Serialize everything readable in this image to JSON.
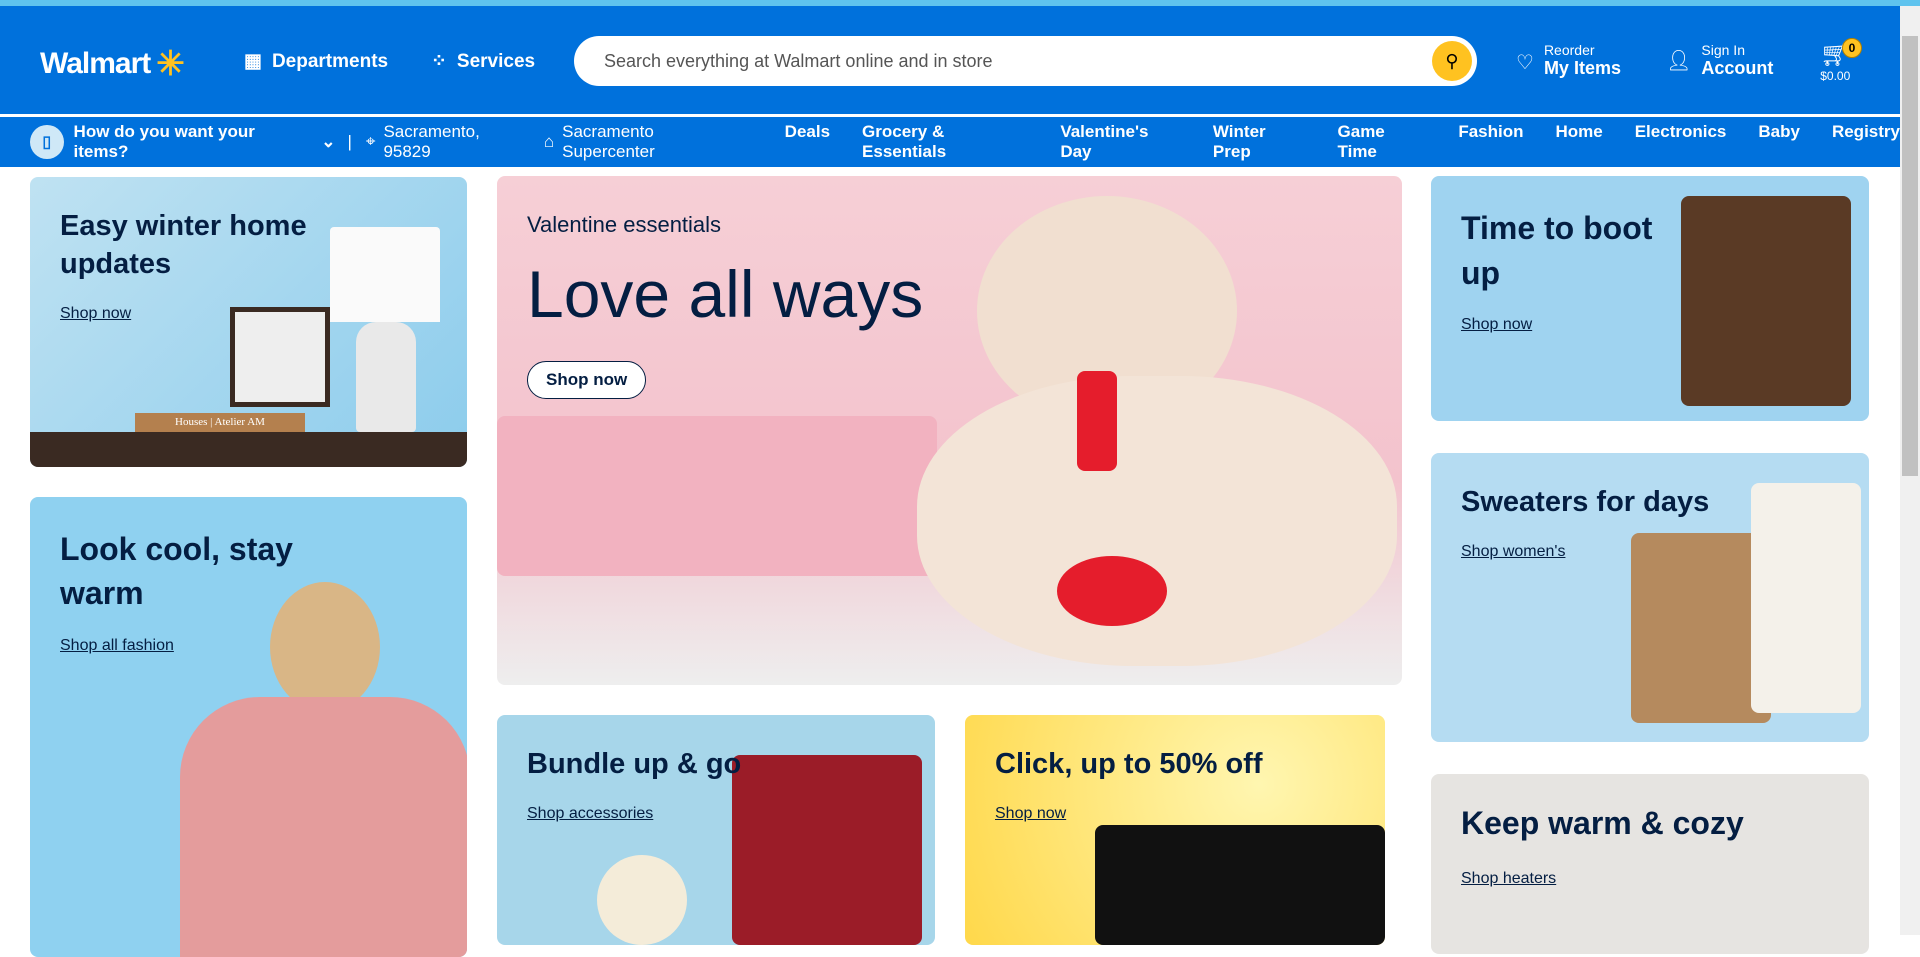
{
  "header": {
    "logo": "Walmart",
    "departments": "Departments",
    "services": "Services",
    "search_placeholder": "Search everything at Walmart online and in store",
    "reorder_small": "Reorder",
    "reorder_big": "My Items",
    "signin_small": "Sign In",
    "signin_big": "Account",
    "cart_count": "0",
    "cart_total": "$0.00"
  },
  "nav": {
    "fulfillment": "How do you want your items?",
    "location": "Sacramento, 95829",
    "store": "Sacramento Supercenter",
    "links": [
      "Deals",
      "Grocery & Essentials",
      "Valentine's Day",
      "Winter Prep",
      "Game Time",
      "Fashion",
      "Home",
      "Electronics",
      "Baby",
      "Registry"
    ]
  },
  "cards": {
    "winter_home": {
      "title": "Easy winter home updates",
      "link": "Shop now",
      "book_text": "Houses | Atelier AM"
    },
    "look_cool": {
      "title": "Look cool, stay warm",
      "link": "Shop all fashion"
    },
    "hero": {
      "eyebrow": "Valentine essentials",
      "title": "Love all ways",
      "button": "Shop now"
    },
    "bundle": {
      "title": "Bundle up & go",
      "link": "Shop accessories"
    },
    "click": {
      "title": "Click, up to 50% off",
      "link": "Shop now"
    },
    "boot": {
      "title": "Time to boot up",
      "link": "Shop now"
    },
    "sweaters": {
      "title": "Sweaters for days",
      "link": "Shop women's"
    },
    "cozy": {
      "title": "Keep warm & cozy",
      "link": "Shop heaters"
    }
  },
  "colors": {
    "brand": "#0071dc",
    "spark": "#ffc220",
    "text": "#041e42"
  }
}
